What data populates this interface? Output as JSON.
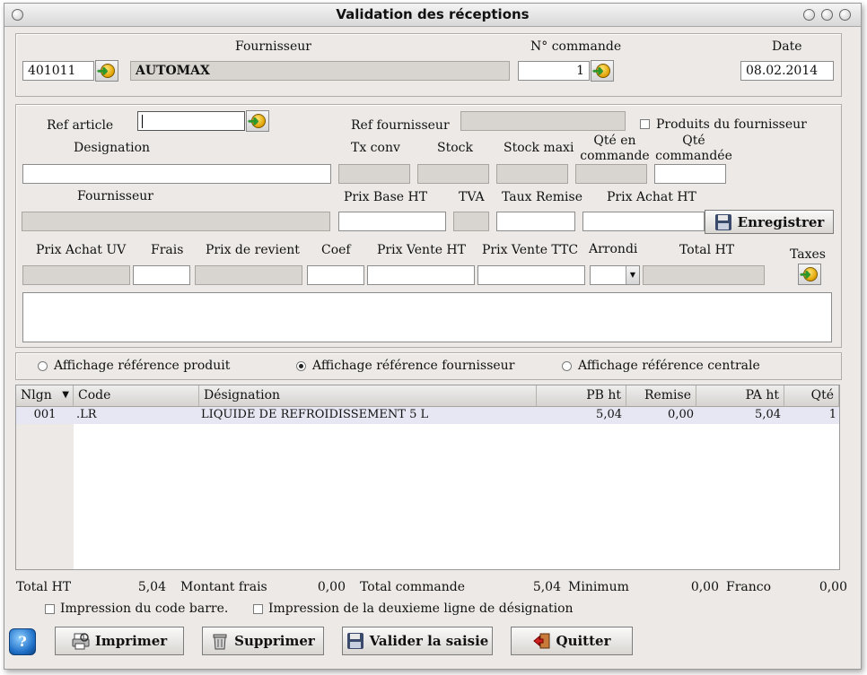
{
  "window": {
    "title": "Validation des  réceptions"
  },
  "header": {
    "fournisseur_label": "Fournisseur",
    "supplier_code": "401011",
    "supplier_name": "AUTOMAX",
    "commande_label": "N° commande",
    "commande_value": "1",
    "date_label": "Date",
    "date_value": "08.02.2014"
  },
  "article": {
    "ref_article_label": "Ref article",
    "ref_article_value": "",
    "ref_fournisseur_label": "Ref fournisseur",
    "produits_fournisseur_label": "Produits du fournisseur",
    "designation_label": "Designation",
    "tx_conv_label": "Tx conv",
    "stock_label": "Stock",
    "stock_maxi_label": "Stock maxi",
    "qte_en_commande_label": "Qté en commande",
    "qte_commandee_label": "Qté commandée",
    "fournisseur_label": "Fournisseur",
    "prix_base_ht_label": "Prix Base HT",
    "tva_label": "TVA",
    "taux_remise_label": "Taux Remise",
    "prix_achat_ht_label": "Prix Achat HT",
    "enregistrer_label": "Enregistrer",
    "prix_achat_uv_label": "Prix Achat UV",
    "frais_label": "Frais",
    "prix_revient_label": "Prix de revient",
    "coef_label": "Coef",
    "prix_vente_ht_label": "Prix Vente HT",
    "prix_vente_ttc_label": "Prix Vente TTC",
    "arrondi_label": "Arrondi",
    "total_ht_label": "Total HT",
    "taxes_label": "Taxes"
  },
  "display_options": [
    {
      "label": "Affichage référence produit",
      "selected": false
    },
    {
      "label": "Affichage référence fournisseur",
      "selected": true
    },
    {
      "label": "Affichage référence centrale",
      "selected": false
    }
  ],
  "table": {
    "columns": [
      "Nlgn",
      "Code",
      "Désignation",
      "PB ht",
      "Remise",
      "PA ht",
      "Qté"
    ],
    "rows": [
      [
        "001",
        ".LR",
        "LIQUIDE DE REFROIDISSEMENT 5 L",
        "5,04",
        "0,00",
        "5,04",
        "1"
      ]
    ]
  },
  "totals": {
    "total_ht_label": "Total HT",
    "total_ht_value": "5,04",
    "montant_frais_label": "Montant frais",
    "montant_frais_value": "0,00",
    "total_commande_label": "Total commande",
    "total_commande_value": "5,04",
    "minimum_label": "Minimum",
    "minimum_value": "0,00",
    "franco_label": "Franco",
    "franco_value": "0,00"
  },
  "print_options": {
    "code_barre_label": "Impression du code barre.",
    "deuxieme_ligne_label": "Impression de la deuxieme ligne de désignation"
  },
  "buttons": {
    "imprimer": "Imprimer",
    "supprimer": "Supprimer",
    "valider": "Valider la saisie",
    "quitter": "Quitter"
  },
  "icons": {
    "go": "arrow-go-icon",
    "save": "floppy-icon",
    "print": "printer-icon",
    "delete": "trash-icon",
    "exit": "exit-door-icon",
    "help": "help-orb-icon"
  }
}
